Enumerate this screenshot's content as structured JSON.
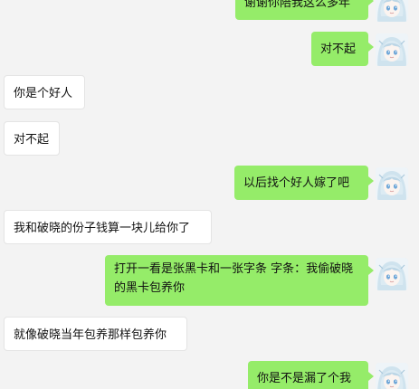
{
  "chat": {
    "messages": [
      {
        "side": "out",
        "text": "谢谢你陪我这么多年"
      },
      {
        "side": "out",
        "text": "对不起"
      },
      {
        "side": "in",
        "text": "你是个好人"
      },
      {
        "side": "in",
        "text": "对不起"
      },
      {
        "side": "out",
        "text": "以后找个好人嫁了吧"
      },
      {
        "side": "in",
        "text": "我和破晓的份子钱算一块儿给你了"
      },
      {
        "side": "out",
        "text": "打开一看是张黑卡和一张字条 字条：我偷破晓的黑卡包养你"
      },
      {
        "side": "in",
        "text": "就像破晓当年包养那样包养你"
      },
      {
        "side": "out",
        "text": "你是不是漏了个我"
      }
    ]
  },
  "colors": {
    "background": "#f3f3f3",
    "outgoing_bubble": "#95ec69",
    "incoming_bubble": "#ffffff"
  },
  "icons": {
    "avatar": "anime-character-avatar-icon"
  }
}
